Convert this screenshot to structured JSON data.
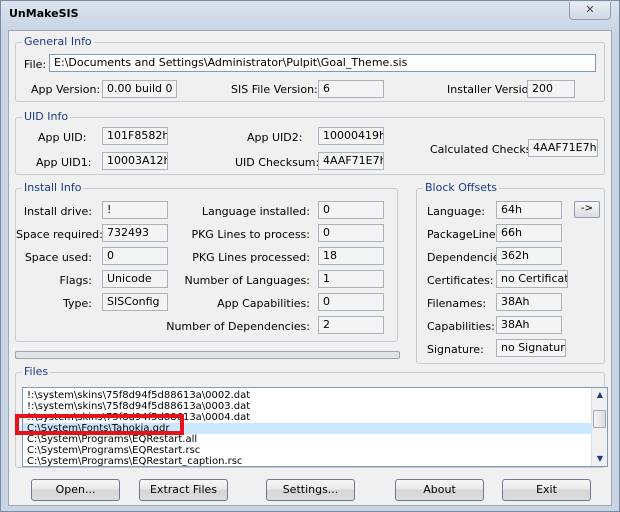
{
  "window": {
    "title": "UnMakeSIS",
    "close_glyph": "✕"
  },
  "general_info": {
    "group_label": "General Info",
    "file_label": "File:",
    "file_value": "E:\\Documents and Settings\\Administrator\\Pulpit\\Goal_Theme.sis",
    "app_version_label": "App Version:",
    "app_version_value": "0.00 build 0",
    "sis_file_version_label": "SIS File Version:",
    "sis_file_version_value": "6",
    "installer_version_label": "Installer Version:",
    "installer_version_value": "200"
  },
  "uid_info": {
    "group_label": "UID Info",
    "app_uid_label": "App UID:",
    "app_uid_value": "101F8582h",
    "app_uid1_label": "App UID1:",
    "app_uid1_value": "10003A12h",
    "app_uid2_label": "App UID2:",
    "app_uid2_value": "10000419h",
    "uid_checksum_label": "UID Checksum:",
    "uid_checksum_value": "4AAF71E7h",
    "calculated_checksum_label": "Calculated Checksum:",
    "calculated_checksum_value": "4AAF71E7h"
  },
  "install_info": {
    "group_label": "Install Info",
    "install_drive_label": "Install drive:",
    "install_drive_value": "!",
    "space_required_label": "Space required:",
    "space_required_value": "732493",
    "space_used_label": "Space used:",
    "space_used_value": "0",
    "flags_label": "Flags:",
    "flags_value": "Unicode",
    "type_label": "Type:",
    "type_value": "SISConfig",
    "language_installed_label": "Language installed:",
    "language_installed_value": "0",
    "pkg_lines_to_process_label": "PKG Lines to process:",
    "pkg_lines_to_process_value": "0",
    "pkg_lines_processed_label": "PKG Lines processed:",
    "pkg_lines_processed_value": "18",
    "number_of_languages_label": "Number of Languages:",
    "number_of_languages_value": "1",
    "app_capabilities_label": "App Capabilities:",
    "app_capabilities_value": "0",
    "number_of_dependencies_label": "Number of Dependencies:",
    "number_of_dependencies_value": "2"
  },
  "block_offsets": {
    "group_label": "Block Offsets",
    "language_label": "Language:",
    "language_value": "64h",
    "arrow_button": "->",
    "package_lines_label": "PackageLines:",
    "package_lines_value": "66h",
    "dependencies_label": "Dependencies:",
    "dependencies_value": "362h",
    "certificates_label": "Certificates:",
    "certificates_value": "no Certificate",
    "filenames_label": "Filenames:",
    "filenames_value": "38Ah",
    "capabilities_label": "Capabilities:",
    "capabilities_value": "38Ah",
    "signature_label": "Signature:",
    "signature_value": "no Signature"
  },
  "progress": {
    "fraction": 0.0
  },
  "files": {
    "group_label": "Files",
    "items": [
      "!:\\system\\skins\\75f8d94f5d88613a\\0002.dat",
      "!:\\system\\skins\\75f8d94f5d88613a\\0003.dat",
      "!:\\system\\skins\\75f8d94f5d88613a\\0004.dat",
      "C:\\System\\Fonts\\Tahokia.gdr",
      "C:\\System\\Programs\\EQRestart.all",
      "C:\\System\\Programs\\EQRestart.rsc",
      "C:\\System\\Programs\\EQRestart_caption.rsc"
    ],
    "selected_index": 3
  },
  "buttons": {
    "open": "Open...",
    "extract_files": "Extract Files",
    "settings": "Settings...",
    "about": "About",
    "exit": "Exit"
  },
  "colors": {
    "highlight_border": "#e8101a",
    "selection": "#cce8ff",
    "group_label": "#1a3a86"
  }
}
